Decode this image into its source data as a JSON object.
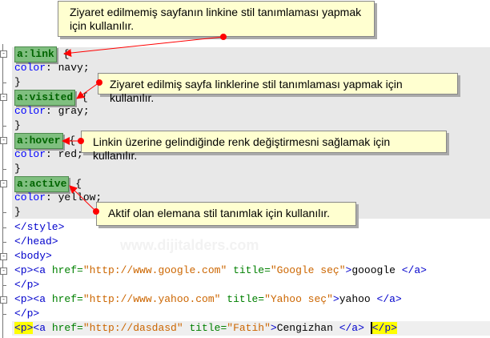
{
  "watermark": "www.dijitalders.com",
  "code": {
    "link_sel": "a:link",
    "link_rest": " {",
    "link_prop": "color",
    "link_val": ": navy;",
    "close": "}",
    "visited_sel": "a:visited",
    "visited_rest": " {",
    "visited_prop": "color",
    "visited_val": ": gray;",
    "hover_sel": "a:hover",
    "hover_rest": " {",
    "hover_prop": "color",
    "hover_val": ": red;",
    "active_sel": "a:active",
    "active_rest": " {",
    "active_prop": "color",
    "active_val": ": yellow;",
    "style_close": "</style>",
    "head_close": "</head>",
    "body_open": "<body>",
    "p_open": "<p>",
    "a_open": "<a ",
    "href": "href=",
    "title": " title=",
    "google_href": "\"http://www.google.com\"",
    "google_title": "\"Google seç\"",
    "gt": ">",
    "google_text": "gooogle ",
    "a_close": "</a>",
    "p_close": "</p>",
    "yahoo_href": "\"http://www.yahoo.com\"",
    "yahoo_title": "\"Yahoo seç\"",
    "yahoo_text": "yahoo ",
    "last_href": "\"http://dasdasd\"",
    "last_title": "\"Fatih\"",
    "last_text": "Cengizhan "
  },
  "notes": {
    "link": "Ziyaret edilmemiş sayfanın linkine stil tanımlaması yapmak için kullanılır.",
    "visited": "Ziyaret edilmiş sayfa linklerine stil tanımlaması yapmak için kullanılır.",
    "hover": "Linkin üzerine gelindiğinde renk değiştirmesni sağlamak için kullanılır.",
    "active": "Aktif olan elemana stil tanımlak için kullanılır."
  },
  "colors": {
    "annotation": "#ff0000",
    "note_bg": "#ffffd0",
    "selector_bg": "#7fbf7f",
    "highlight": "#ffff00"
  }
}
